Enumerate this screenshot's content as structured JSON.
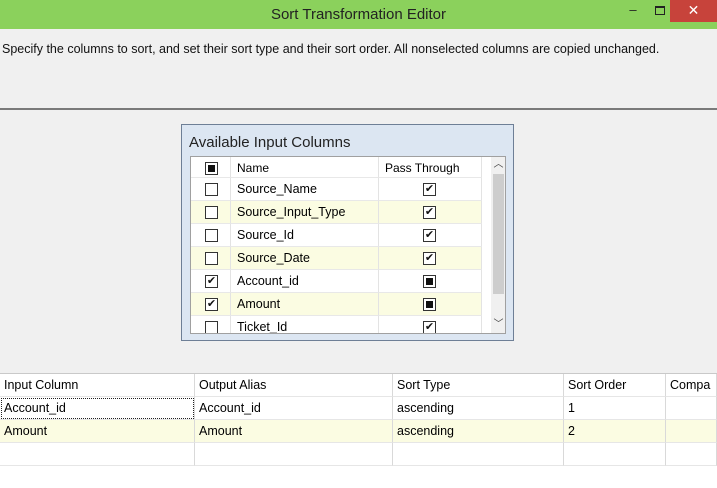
{
  "window": {
    "title": "Sort Transformation Editor",
    "minimize_glyph": "–",
    "close_glyph": "✕"
  },
  "instructions": "Specify the columns to sort, and set their sort type and their sort order. All nonselected columns are copied unchanged.",
  "available": {
    "title": "Available Input Columns",
    "headers": {
      "name": "Name",
      "pass_through": "Pass Through"
    },
    "header_check_state": "indeterminate",
    "rows": [
      {
        "name": "Source_Name",
        "checked": false,
        "pass_through": "checked"
      },
      {
        "name": "Source_Input_Type",
        "checked": false,
        "pass_through": "checked"
      },
      {
        "name": "Source_Id",
        "checked": false,
        "pass_through": "checked"
      },
      {
        "name": "Source_Date",
        "checked": false,
        "pass_through": "checked"
      },
      {
        "name": "Account_id",
        "checked": true,
        "pass_through": "indeterminate"
      },
      {
        "name": "Amount",
        "checked": true,
        "pass_through": "indeterminate"
      },
      {
        "name": "Ticket_Id",
        "checked": false,
        "pass_through": "checked"
      }
    ],
    "scroll_up_glyph": "︿",
    "scroll_down_glyph": "﹀"
  },
  "sort_grid": {
    "headers": {
      "input_column": "Input Column",
      "output_alias": "Output Alias",
      "sort_type": "Sort Type",
      "sort_order": "Sort Order",
      "comparison": "Compa"
    },
    "rows": [
      {
        "input_column": "Account_id",
        "output_alias": "Account_id",
        "sort_type": "ascending",
        "sort_order": "1",
        "comparison": ""
      },
      {
        "input_column": "Amount",
        "output_alias": "Amount",
        "sort_type": "ascending",
        "sort_order": "2",
        "comparison": ""
      }
    ]
  },
  "colors": {
    "title_bar": "#8bd15c",
    "close_button": "#c7433b",
    "row_highlight": "#fbfce2",
    "group_box": "#dce6f2"
  }
}
